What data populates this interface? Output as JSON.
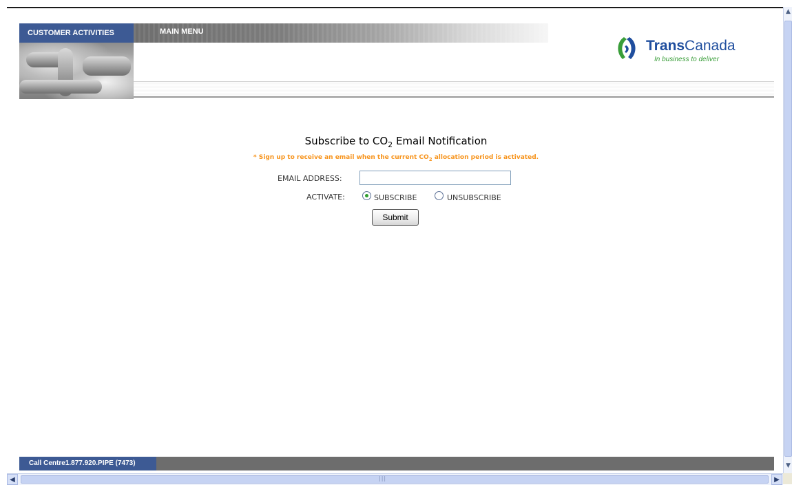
{
  "header": {
    "tab_customer_activities": "CUSTOMER ACTIVITIES",
    "tab_main_menu": "MAIN MENU",
    "logo": {
      "name_bold": "Trans",
      "name_regular": "Canada",
      "tagline": "In business to deliver"
    }
  },
  "form": {
    "title_prefix": "Subscribe to CO",
    "title_subscript": "2",
    "title_suffix": " Email Notification",
    "note_prefix": "* Sign up to receive an email when the current CO",
    "note_subscript": "2",
    "note_suffix": " allocation period is activated.",
    "email_label": "EMAIL ADDRESS:",
    "email_value": "",
    "activate_label": "ACTIVATE:",
    "options": [
      {
        "label": "SUBSCRIBE",
        "checked": true
      },
      {
        "label": "UNSUBSCRIBE",
        "checked": false
      }
    ],
    "submit_label": "Submit"
  },
  "footer": {
    "call_centre": "Call Centre1.877.920.PIPE (7473)"
  },
  "colors": {
    "nav_blue": "#3d5a94",
    "brand_blue": "#1f4e9e",
    "brand_green": "#3a9e3a",
    "note_orange": "#f7941d",
    "radio_green": "#2f9e2f"
  },
  "icons": {
    "logo_mark": "transcanada-logo-icon",
    "scroll_up": "scroll-up-arrow-icon",
    "scroll_down": "scroll-down-arrow-icon",
    "scroll_left": "scroll-left-arrow-icon",
    "scroll_right": "scroll-right-arrow-icon"
  }
}
